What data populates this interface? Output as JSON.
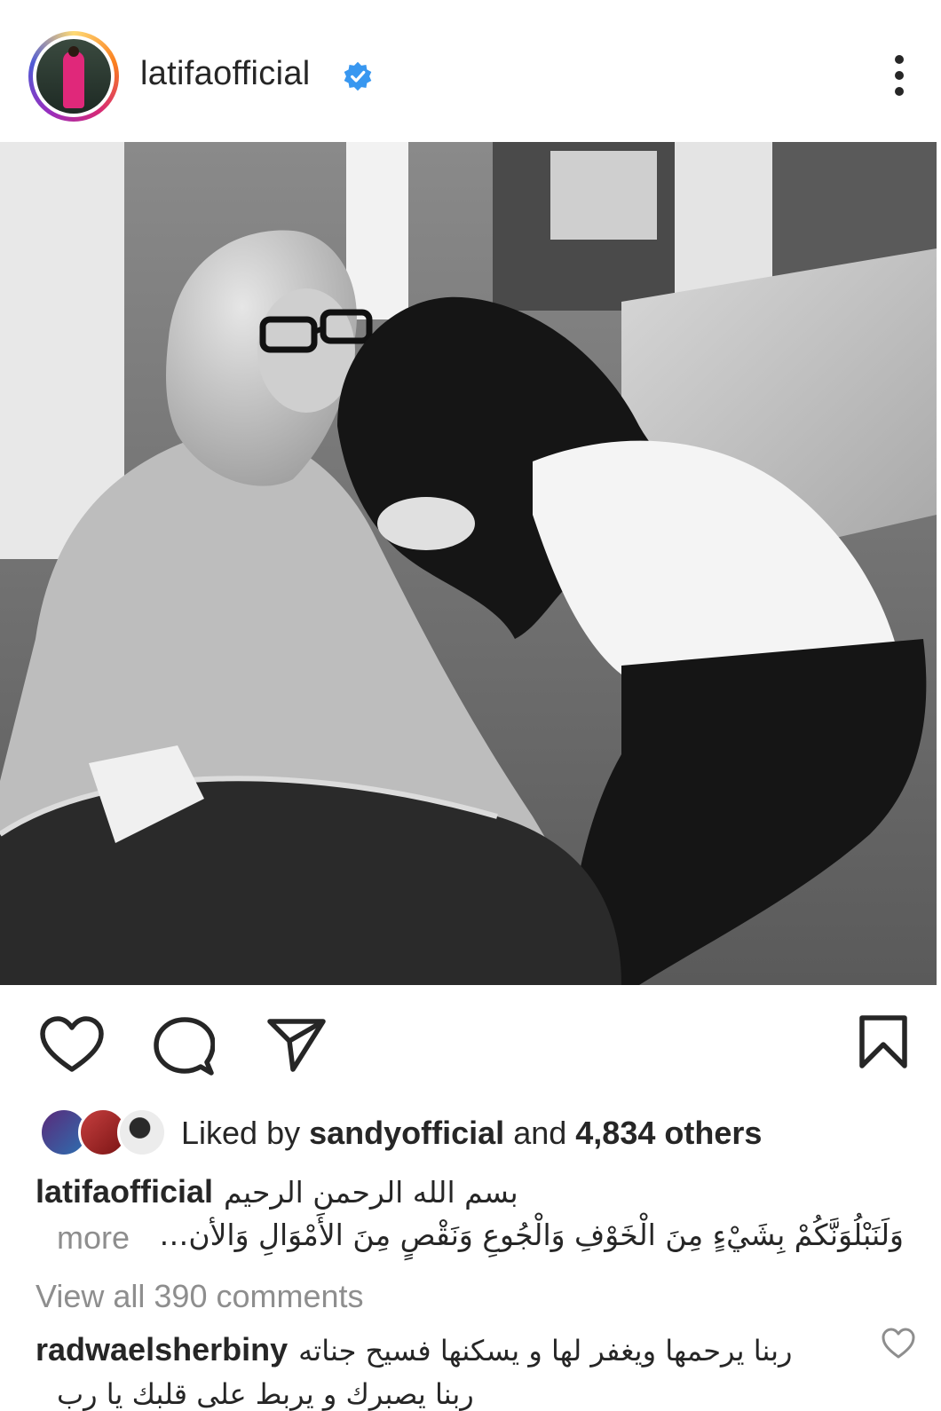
{
  "post": {
    "username": "latifaofficial",
    "verified": true,
    "image_alt": "Black and white photo of a woman kissing the hand of an elderly woman in a headscarf"
  },
  "icons": {
    "like": "heart-outline-icon",
    "comment": "comment-bubble-icon",
    "share": "paper-plane-icon",
    "save": "bookmark-outline-icon",
    "more": "more-vertical-icon",
    "verified": "verified-badge-icon"
  },
  "colors": {
    "verified_blue": "#3897f0",
    "text_primary": "#262626",
    "text_secondary": "#8e8e8e"
  },
  "likes": {
    "prefix": "Liked by",
    "user": "sandyofficial",
    "mid": "and",
    "count_text": "4,834 others"
  },
  "caption": {
    "username": "latifaofficial",
    "line1": "بسم الله الرحمن الرحيم",
    "line2": "وَلَنَبْلُوَنَّكُمْ بِشَيْءٍ مِنَ الْخَوْفِ وَالْجُوعِ وَنَقْصٍ مِنَ الأَمْوَالِ وَالأن…",
    "more": "more"
  },
  "comments": {
    "view_all": "View all 390 comments",
    "items": [
      {
        "username": "radwaelsherbiny",
        "text": "ربنا يرحمها  ويغفر لها و يسكنها فسيح جناته",
        "text_line2": "ربنا يصبرك و يربط على قلبك يا رب"
      }
    ]
  }
}
